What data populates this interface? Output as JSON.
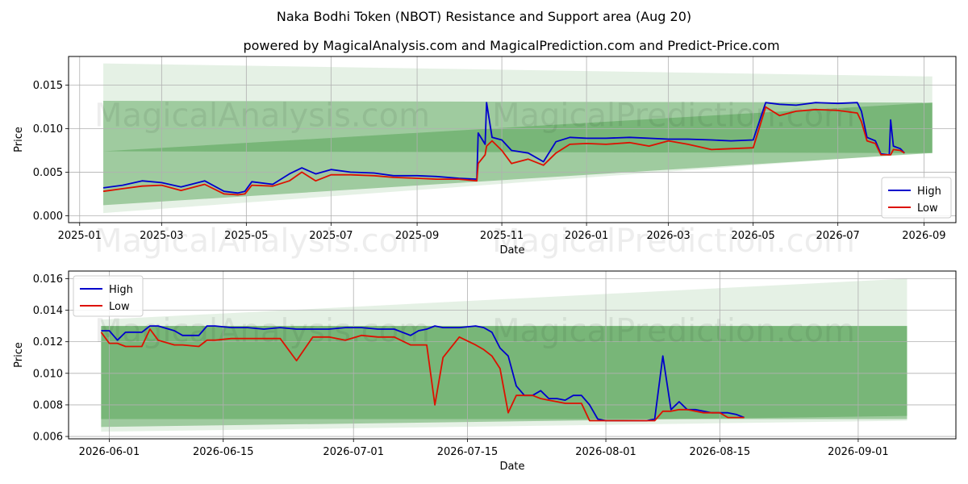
{
  "title": "Naka Bodhi Token (NBOT) Resistance and Support area (Aug 20)",
  "subtitle": "powered by MagicalAnalysis.com and MagicalPrediction.com and Predict-Price.com",
  "watermarks": [
    "MagicalAnalysis.com",
    "MagicalPrediction.com"
  ],
  "colors": {
    "high": "#0000cc",
    "low": "#dd1100",
    "band_dark": "#4a9e4a",
    "band_light": "#cfe6cf"
  },
  "chart_data": [
    {
      "type": "line",
      "xlabel": "Date",
      "ylabel": "Price",
      "grid": true,
      "legend": "bottom-right",
      "xlim": [
        "2024-12-24",
        "2026-09-24"
      ],
      "ylim": [
        -0.0008,
        0.0183
      ],
      "xticks": [
        "2025-01",
        "2025-03",
        "2025-05",
        "2025-07",
        "2025-09",
        "2025-11",
        "2026-01",
        "2026-03",
        "2026-05",
        "2026-07",
        "2026-09"
      ],
      "xtick_dates": [
        "2025-01-01",
        "2025-03-01",
        "2025-05-01",
        "2025-07-01",
        "2025-09-01",
        "2025-11-01",
        "2026-01-01",
        "2026-03-01",
        "2026-05-01",
        "2026-07-01",
        "2026-09-01"
      ],
      "yticks": [
        "0.000",
        "0.005",
        "0.010",
        "0.015"
      ],
      "ytick_values": [
        0,
        0.005,
        0.01,
        0.015
      ],
      "bands": [
        {
          "shade": "light",
          "start": "2025-01-18",
          "end": "2026-09-07",
          "upper": [
            0.0175,
            0.016
          ],
          "lower": [
            0.0003,
            0.0073
          ]
        },
        {
          "shade": "dark",
          "start": "2025-01-18",
          "end": "2026-09-07",
          "upper": [
            0.0132,
            0.013
          ],
          "lower": [
            0.0012,
            0.0072
          ]
        },
        {
          "shade": "dark",
          "start": "2025-01-18",
          "end": "2026-09-07",
          "upper": [
            0.0074,
            0.013
          ],
          "lower": [
            0.0074,
            0.0072
          ]
        }
      ],
      "series": [
        {
          "name": "High",
          "x": [
            "2025-01-18",
            "2025-02-01",
            "2025-02-15",
            "2025-03-01",
            "2025-03-15",
            "2025-04-01",
            "2025-04-15",
            "2025-04-25",
            "2025-04-30",
            "2025-05-05",
            "2025-05-20",
            "2025-06-01",
            "2025-06-10",
            "2025-06-20",
            "2025-07-01",
            "2025-07-15",
            "2025-08-01",
            "2025-08-15",
            "2025-09-01",
            "2025-09-15",
            "2025-10-01",
            "2025-10-14",
            "2025-10-15",
            "2025-10-20",
            "2025-10-21",
            "2025-10-25",
            "2025-11-01",
            "2025-11-08",
            "2025-11-20",
            "2025-12-01",
            "2025-12-10",
            "2025-12-20",
            "2026-01-01",
            "2026-01-15",
            "2026-02-01",
            "2026-02-15",
            "2026-03-01",
            "2026-03-15",
            "2026-04-01",
            "2026-04-15",
            "2026-05-01",
            "2026-05-10",
            "2026-05-20",
            "2026-06-01",
            "2026-06-15",
            "2026-07-01",
            "2026-07-15",
            "2026-07-18",
            "2026-07-22",
            "2026-07-28",
            "2026-08-01",
            "2026-08-07",
            "2026-08-08",
            "2026-08-10",
            "2026-08-15",
            "2026-08-18"
          ],
          "values": [
            0.0032,
            0.0035,
            0.004,
            0.0038,
            0.0033,
            0.004,
            0.0028,
            0.0026,
            0.0028,
            0.0039,
            0.0036,
            0.0048,
            0.0055,
            0.0048,
            0.0053,
            0.005,
            0.0049,
            0.0046,
            0.0046,
            0.0045,
            0.0043,
            0.0042,
            0.0095,
            0.0082,
            0.013,
            0.009,
            0.0087,
            0.0075,
            0.0072,
            0.0062,
            0.0085,
            0.009,
            0.0089,
            0.0089,
            0.009,
            0.0089,
            0.0088,
            0.0088,
            0.0087,
            0.0086,
            0.0087,
            0.013,
            0.0128,
            0.0127,
            0.013,
            0.0129,
            0.013,
            0.012,
            0.009,
            0.0086,
            0.0071,
            0.007,
            0.011,
            0.008,
            0.0077,
            0.0072
          ]
        },
        {
          "name": "Low",
          "x": [
            "2025-01-18",
            "2025-02-01",
            "2025-02-15",
            "2025-03-01",
            "2025-03-15",
            "2025-04-01",
            "2025-04-15",
            "2025-04-25",
            "2025-04-30",
            "2025-05-05",
            "2025-05-20",
            "2025-06-01",
            "2025-06-10",
            "2025-06-20",
            "2025-07-01",
            "2025-07-15",
            "2025-08-01",
            "2025-08-15",
            "2025-09-01",
            "2025-09-15",
            "2025-10-01",
            "2025-10-14",
            "2025-10-15",
            "2025-10-20",
            "2025-10-21",
            "2025-10-25",
            "2025-11-01",
            "2025-11-08",
            "2025-11-20",
            "2025-12-01",
            "2025-12-10",
            "2025-12-20",
            "2026-01-01",
            "2026-01-15",
            "2026-02-01",
            "2026-02-15",
            "2026-03-01",
            "2026-03-15",
            "2026-04-01",
            "2026-04-15",
            "2026-05-01",
            "2026-05-10",
            "2026-05-20",
            "2026-06-01",
            "2026-06-15",
            "2026-07-01",
            "2026-07-15",
            "2026-07-18",
            "2026-07-22",
            "2026-07-28",
            "2026-08-01",
            "2026-08-07",
            "2026-08-08",
            "2026-08-10",
            "2026-08-15",
            "2026-08-18"
          ],
          "values": [
            0.0028,
            0.0031,
            0.0034,
            0.0035,
            0.0029,
            0.0036,
            0.0025,
            0.0024,
            0.0025,
            0.0035,
            0.0034,
            0.004,
            0.005,
            0.004,
            0.0047,
            0.0047,
            0.0046,
            0.0044,
            0.0043,
            0.0042,
            0.0042,
            0.004,
            0.006,
            0.007,
            0.008,
            0.0086,
            0.0075,
            0.006,
            0.0065,
            0.0058,
            0.0072,
            0.0082,
            0.0083,
            0.0082,
            0.0084,
            0.008,
            0.0086,
            0.0082,
            0.0076,
            0.0077,
            0.0078,
            0.0125,
            0.0115,
            0.012,
            0.0122,
            0.0121,
            0.0118,
            0.0108,
            0.0086,
            0.0083,
            0.007,
            0.007,
            0.007,
            0.0076,
            0.0075,
            0.0072
          ]
        }
      ]
    },
    {
      "type": "line",
      "xlabel": "Date",
      "ylabel": "Price",
      "grid": true,
      "legend": "top-left",
      "xlim": [
        "2026-05-27",
        "2026-09-13"
      ],
      "ylim": [
        0.00585,
        0.01648
      ],
      "xticks": [
        "2026-06-01",
        "2026-06-15",
        "2026-07-01",
        "2026-07-15",
        "2026-08-01",
        "2026-08-15",
        "2026-09-01"
      ],
      "xtick_dates": [
        "2026-06-01",
        "2026-06-15",
        "2026-07-01",
        "2026-07-15",
        "2026-08-01",
        "2026-08-15",
        "2026-09-01"
      ],
      "yticks": [
        "0.006",
        "0.008",
        "0.010",
        "0.012",
        "0.014",
        "0.016"
      ],
      "ytick_values": [
        0.006,
        0.008,
        0.01,
        0.012,
        0.014,
        0.016
      ],
      "bands": [
        {
          "shade": "light",
          "start": "2026-05-31",
          "end": "2026-09-07",
          "upper": [
            0.0134,
            0.016
          ],
          "lower": [
            0.0063,
            0.007
          ]
        },
        {
          "shade": "dark",
          "start": "2026-05-31",
          "end": "2026-09-07",
          "upper": [
            0.013,
            0.013
          ],
          "lower": [
            0.0066,
            0.0073
          ]
        },
        {
          "shade": "dark",
          "start": "2026-05-31",
          "end": "2026-09-07",
          "upper": [
            0.013,
            0.013
          ],
          "lower": [
            0.0071,
            0.0071
          ]
        }
      ],
      "series": [
        {
          "name": "High",
          "x": [
            "2026-05-31",
            "2026-06-01",
            "2026-06-02",
            "2026-06-03",
            "2026-06-05",
            "2026-06-06",
            "2026-06-07",
            "2026-06-09",
            "2026-06-10",
            "2026-06-12",
            "2026-06-13",
            "2026-06-14",
            "2026-06-16",
            "2026-06-18",
            "2026-06-20",
            "2026-06-22",
            "2026-06-24",
            "2026-06-26",
            "2026-06-28",
            "2026-06-30",
            "2026-07-02",
            "2026-07-04",
            "2026-07-06",
            "2026-07-08",
            "2026-07-09",
            "2026-07-10",
            "2026-07-11",
            "2026-07-12",
            "2026-07-14",
            "2026-07-16",
            "2026-07-17",
            "2026-07-18",
            "2026-07-19",
            "2026-07-20",
            "2026-07-21",
            "2026-07-22",
            "2026-07-23",
            "2026-07-24",
            "2026-07-25",
            "2026-07-26",
            "2026-07-27",
            "2026-07-28",
            "2026-07-29",
            "2026-07-30",
            "2026-07-31",
            "2026-08-01",
            "2026-08-02",
            "2026-08-03",
            "2026-08-04",
            "2026-08-05",
            "2026-08-06",
            "2026-08-07",
            "2026-08-08",
            "2026-08-09",
            "2026-08-10",
            "2026-08-11",
            "2026-08-12",
            "2026-08-13",
            "2026-08-14",
            "2026-08-15",
            "2026-08-16",
            "2026-08-17",
            "2026-08-18"
          ],
          "values": [
            0.0127,
            0.0127,
            0.0121,
            0.0126,
            0.0126,
            0.013,
            0.013,
            0.0127,
            0.0124,
            0.0124,
            0.013,
            0.013,
            0.0129,
            0.0129,
            0.0128,
            0.0129,
            0.0128,
            0.0128,
            0.0128,
            0.0129,
            0.0129,
            0.0128,
            0.0128,
            0.0124,
            0.0127,
            0.0128,
            0.013,
            0.0129,
            0.0129,
            0.013,
            0.0129,
            0.0126,
            0.0116,
            0.0111,
            0.0092,
            0.0086,
            0.0086,
            0.0089,
            0.0084,
            0.0084,
            0.0083,
            0.0086,
            0.0086,
            0.008,
            0.0071,
            0.007,
            0.007,
            0.007,
            0.007,
            0.007,
            0.007,
            0.0071,
            0.0111,
            0.0077,
            0.0082,
            0.0077,
            0.0077,
            0.0076,
            0.0075,
            0.0075,
            0.0075,
            0.0074,
            0.0072
          ]
        },
        {
          "name": "Low",
          "x": [
            "2026-05-31",
            "2026-06-01",
            "2026-06-02",
            "2026-06-03",
            "2026-06-05",
            "2026-06-06",
            "2026-06-07",
            "2026-06-09",
            "2026-06-10",
            "2026-06-12",
            "2026-06-13",
            "2026-06-14",
            "2026-06-16",
            "2026-06-18",
            "2026-06-20",
            "2026-06-22",
            "2026-06-24",
            "2026-06-26",
            "2026-06-28",
            "2026-06-30",
            "2026-07-02",
            "2026-07-04",
            "2026-07-06",
            "2026-07-08",
            "2026-07-09",
            "2026-07-10",
            "2026-07-11",
            "2026-07-12",
            "2026-07-14",
            "2026-07-16",
            "2026-07-17",
            "2026-07-18",
            "2026-07-19",
            "2026-07-20",
            "2026-07-21",
            "2026-07-22",
            "2026-07-23",
            "2026-07-24",
            "2026-07-25",
            "2026-07-26",
            "2026-07-27",
            "2026-07-28",
            "2026-07-29",
            "2026-07-30",
            "2026-07-31",
            "2026-08-01",
            "2026-08-02",
            "2026-08-03",
            "2026-08-04",
            "2026-08-05",
            "2026-08-06",
            "2026-08-07",
            "2026-08-08",
            "2026-08-09",
            "2026-08-10",
            "2026-08-11",
            "2026-08-12",
            "2026-08-13",
            "2026-08-14",
            "2026-08-15",
            "2026-08-16",
            "2026-08-17",
            "2026-08-18"
          ],
          "values": [
            0.0126,
            0.0119,
            0.0119,
            0.0117,
            0.0117,
            0.0128,
            0.0121,
            0.0118,
            0.0118,
            0.0117,
            0.0121,
            0.0121,
            0.0122,
            0.0122,
            0.0122,
            0.0122,
            0.0108,
            0.0123,
            0.0123,
            0.0121,
            0.0124,
            0.0123,
            0.0123,
            0.0118,
            0.0118,
            0.0118,
            0.008,
            0.011,
            0.0123,
            0.0118,
            0.0115,
            0.0111,
            0.0103,
            0.0075,
            0.0086,
            0.0086,
            0.0086,
            0.0084,
            0.0083,
            0.0082,
            0.0081,
            0.0081,
            0.0081,
            0.007,
            0.007,
            0.007,
            0.007,
            0.007,
            0.007,
            0.007,
            0.007,
            0.007,
            0.0076,
            0.0076,
            0.0077,
            0.0077,
            0.0076,
            0.0075,
            0.0075,
            0.0075,
            0.0072,
            0.0072,
            0.0072
          ]
        }
      ]
    }
  ]
}
